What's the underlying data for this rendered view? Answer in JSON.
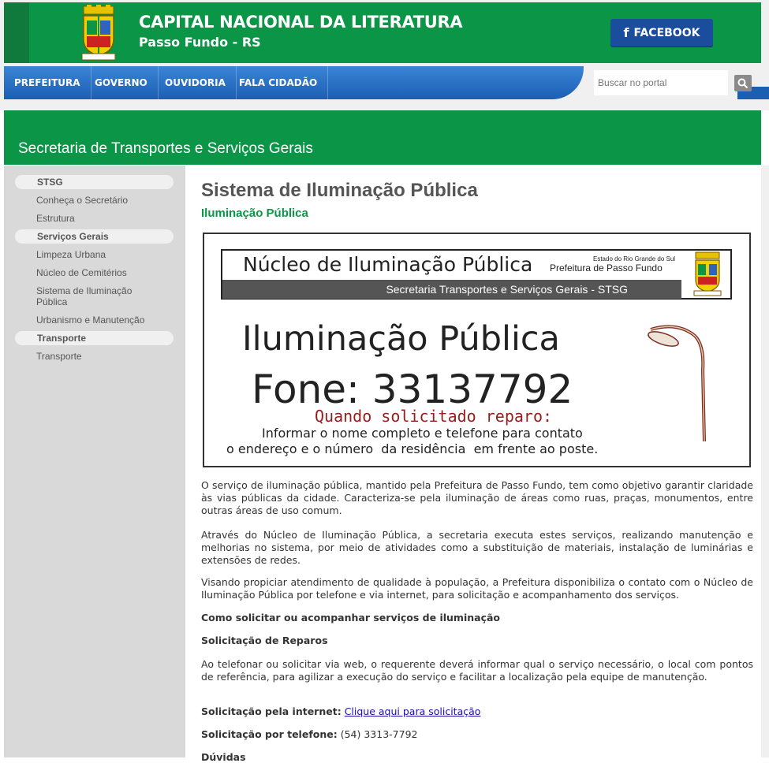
{
  "header": {
    "title": "CAPITAL NACIONAL DA LITERATURA",
    "subtitle": "Passo Fundo - RS",
    "facebook_label": "FACEBOOK",
    "colors": {
      "green": "#0a9646",
      "blue": "#1b5fb3",
      "facebook": "#1a4d9c"
    }
  },
  "nav": {
    "items": [
      {
        "label": "PREFEITURA"
      },
      {
        "label": "GOVERNO"
      },
      {
        "label": "OUVIDORIA"
      },
      {
        "label": "FALA CIDADÃO"
      }
    ]
  },
  "search": {
    "placeholder": "Buscar no portal",
    "icon": "search-icon"
  },
  "banner": {
    "title": "Secretaria de Transportes e Serviços Gerais"
  },
  "sidebar": {
    "sections": [
      {
        "heading": "STSG",
        "links": [
          "Conheça o Secretário",
          "Estrutura"
        ]
      },
      {
        "heading": "Serviços Gerais",
        "links": [
          "Limpeza Urbana",
          "Núcleo de Cemitérios",
          "Sistema de Iluminação Pública",
          "Urbanismo e Manutenção"
        ]
      },
      {
        "heading": "Transporte",
        "links": [
          "Transporte"
        ]
      }
    ]
  },
  "main": {
    "title": "Sistema de Iluminação Pública",
    "subtitle": "Iluminação Pública",
    "poster": {
      "header_title": "Núcleo de Iluminação Pública",
      "state": "Estado do Rio Grande do Sul",
      "prefeitura": "Prefeitura de Passo Fundo",
      "strip": "Secretaria Transportes e Serviços Gerais - STSG",
      "big": "Iluminação Pública",
      "phone": "Fone: 33137792",
      "when": "Quando solicitado reparo:",
      "line1": "Informar o nome completo e telefone para contato",
      "line2": "o endereço e o número  da residência  em frente ao poste."
    },
    "paragraphs": [
      "O serviço de iluminação pública, mantido pela Prefeitura de Passo Fundo, tem como objetivo garantir claridade às vias públicas da cidade. Caracteriza-se pela iluminação de áreas como ruas, praças, monumentos, entre outras áreas de uso comum.",
      "Através do Núcleo de Iluminação Pública, a secretaria executa estes serviços, realizando manutenção e melhorias no sistema, por meio de atividades como a substituição de materiais, instalação de luminárias e extensões de redes.",
      "Visando propiciar atendimento de qualidade à população, a Prefeitura disponibiliza o contato com o Núcleo de Iluminação Pública por telefone e via internet, para solicitação e acompanhamento dos serviços."
    ],
    "how_heading": "Como solicitar ou acompanhar serviços de iluminação",
    "repairs_heading": "Solicitação de Reparos",
    "repairs_text": "Ao telefonar ou solicitar via web, o requerente deverá informar qual o serviço necessário, o local com pontos de referência, para agilizar a execução do serviço e facilitar a localização pela equipe de manutenção.",
    "internet_label": "Solicitação pela internet:",
    "internet_link": "Clique aqui para solicitação",
    "phone_label": "Solicitação por telefone:",
    "phone_value": "(54) 3313-7792",
    "doubts_heading": "Dúvidas"
  }
}
